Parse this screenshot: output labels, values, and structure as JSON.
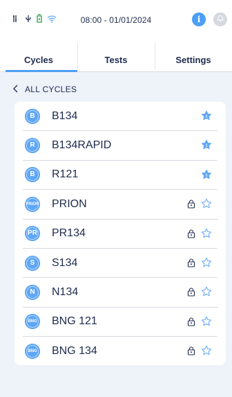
{
  "status_bar": {
    "clock": "08:00 - 01/01/2024",
    "icons": [
      "usb-icon",
      "tool-icon",
      "battery-icon",
      "wifi-icon"
    ],
    "info_label": "i",
    "accent": "#4c9ff4"
  },
  "tabs": [
    {
      "label": "Cycles",
      "active": true
    },
    {
      "label": "Tests",
      "active": false
    },
    {
      "label": "Settings",
      "active": false
    }
  ],
  "back": {
    "label": "ALL CYCLES"
  },
  "cycles": [
    {
      "name": "B134",
      "icon_text": "B",
      "locked": false,
      "favorite": true
    },
    {
      "name": "B134RAPID",
      "icon_text": "R",
      "locked": false,
      "favorite": true
    },
    {
      "name": "R121",
      "icon_text": "B",
      "locked": false,
      "favorite": true
    },
    {
      "name": "PRION",
      "icon_text": "PRION",
      "locked": true,
      "favorite": false
    },
    {
      "name": "PR134",
      "icon_text": "PR",
      "locked": true,
      "favorite": false
    },
    {
      "name": "S134",
      "icon_text": "S",
      "locked": true,
      "favorite": false
    },
    {
      "name": "N134",
      "icon_text": "N",
      "locked": true,
      "favorite": false
    },
    {
      "name": "BNG 121",
      "icon_text": "BNG",
      "locked": true,
      "favorite": false
    },
    {
      "name": "BNG 134",
      "icon_text": "BNG",
      "locked": true,
      "favorite": false
    }
  ]
}
